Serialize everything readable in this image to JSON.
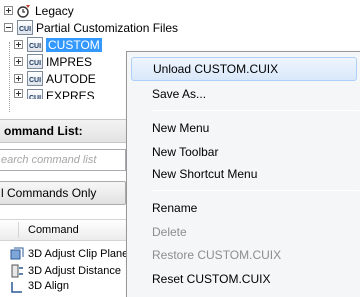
{
  "tree": {
    "items": [
      {
        "label": "Legacy",
        "icon": "legacy-icon",
        "expander": "plus"
      },
      {
        "label": "Partial Customization Files",
        "icon": "cui-file-icon",
        "expander": "minus"
      },
      {
        "label": "CUSTOM",
        "icon": "cui-file-icon",
        "expander": "plus",
        "selected": true
      },
      {
        "label": "IMPRES",
        "icon": "cui-file-icon",
        "expander": "plus"
      },
      {
        "label": "AUTODE",
        "icon": "cui-file-icon",
        "expander": "plus"
      },
      {
        "label": "EXPRES",
        "icon": "cui-file-icon",
        "expander": "plus"
      }
    ],
    "icon_text": "CUI"
  },
  "command_panel": {
    "title": "ommand List:",
    "search_placeholder": "earch command list",
    "filter_value": "l Commands Only",
    "column_header": "Command",
    "rows": [
      {
        "label": "3D Adjust Clip Plane",
        "icon": "clip-plane-icon"
      },
      {
        "label": "3D Adjust Distance",
        "icon": "distance-icon"
      },
      {
        "label": "3D Align",
        "icon": "align-icon"
      }
    ]
  },
  "context_menu": {
    "items": [
      {
        "label": "Unload CUSTOM.CUIX",
        "state": "hover"
      },
      {
        "label": "Save As...",
        "state": "normal"
      },
      {
        "label": "New Menu",
        "state": "normal"
      },
      {
        "label": "New Toolbar",
        "state": "normal"
      },
      {
        "label": "New Shortcut Menu",
        "state": "normal"
      },
      {
        "label": "Rename",
        "state": "normal"
      },
      {
        "label": "Delete",
        "state": "disabled"
      },
      {
        "label": "Restore CUSTOM.CUIX",
        "state": "disabled"
      },
      {
        "label": "Reset CUSTOM.CUIX",
        "state": "normal"
      }
    ]
  },
  "colors": {
    "selection": "#3399ff",
    "menu_bg": "#f5f6f7",
    "menu_hover": "#d9e8fa",
    "disabled_text": "#8d8d8d"
  }
}
